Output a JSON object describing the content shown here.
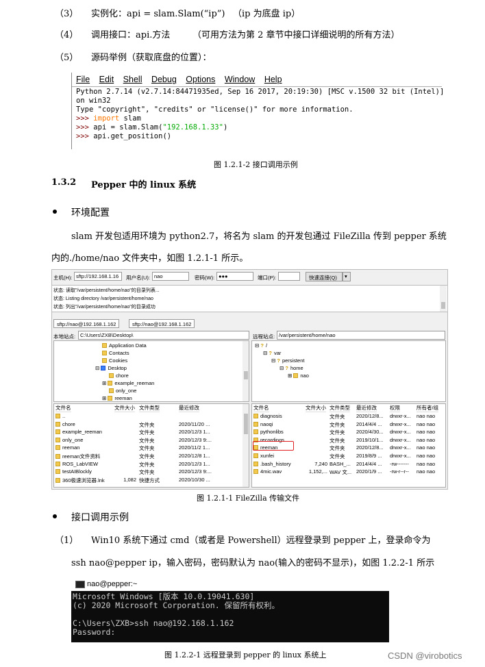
{
  "steps": {
    "s3_num": "（3）",
    "s3_text": "实例化：api = slam.Slam(“ip”)",
    "s3_note": "（ip 为底盘 ip）",
    "s4_num": "（4）",
    "s4_text": "调用接口：api.方法",
    "s4_note": "（可用方法为第 2 章节中接口详细说明的所有方法）",
    "s5_num": "（5）",
    "s5_text": "源码举例（获取底盘的位置）："
  },
  "idle": {
    "menu": [
      "File",
      "Edit",
      "Shell",
      "Debug",
      "Options",
      "Window",
      "Help"
    ],
    "line1": "Python 2.7.14 (v2.7.14:84471935ed, Sep 16 2017, 20:19:30) [MSC v.1500 32 bit (Intel)]",
    "line2": "on win32",
    "line3": "Type \"copyright\", \"credits\" or \"license()\" for more information.",
    "prompt": ">>> ",
    "cmd1_kw": "import",
    "cmd1_rest": " slam",
    "cmd2_pre": "api = slam.Slam(",
    "cmd2_str": "\"192.168.1.33\"",
    "cmd2_post": ")",
    "cmd3": "api.get_position()"
  },
  "fig1_caption": "图 1.2.1-2  接口调用示例",
  "section": {
    "number": "1.3.2",
    "title": "Pepper 中的 linux 系统"
  },
  "bullet1": "环境配置",
  "para1_line1": "slam 开发包适用环境为 python2.7，将名为 slam 的开发包通过 FileZilla 传到 pepper 系统",
  "para1_line2": "内的./home/nao 文件夹中，如图 1.2.1-1 所示。",
  "filezilla": {
    "host_label": "主机(H):",
    "host_value": "sftp://192.168.1.16",
    "user_label": "用户名(U):",
    "user_value": "nao",
    "pass_label": "密码(W):",
    "pass_value": "●●●",
    "port_label": "端口(P):",
    "port_value": "",
    "connect_button": "快速连接(Q)",
    "log": [
      "状态: 读取\"/var/persistent/home/nao\"的目录列表...",
      "状态: Listing directory /var/persistent/home/nao",
      "状态: 列出\"/var/persistent/home/nao\"的目录成功"
    ],
    "tabs": [
      "sftp://nao@192.168.1.162",
      "sftp://nao@192.168.1.162"
    ],
    "local_label": "本地站点:",
    "local_path": "C:\\Users\\ZXB\\Desktop\\",
    "remote_label": "远程站点:",
    "remote_path": "/var/persistent/home/nao",
    "local_tree": [
      "Application Data",
      "Contacts",
      "Cookies",
      "Desktop",
      "chore",
      "example_reeman",
      "only_one",
      "reeman"
    ],
    "remote_tree": [
      "/",
      "var",
      "persistent",
      "home",
      "nao"
    ],
    "local_headers": [
      "文件名",
      "文件大小",
      "文件类型",
      "最近修改"
    ],
    "local_files": [
      {
        "name": "..",
        "size": "",
        "type": "",
        "date": ""
      },
      {
        "name": "chore",
        "size": "",
        "type": "文件夹",
        "date": "2020/11/20 ..."
      },
      {
        "name": "example_reeman",
        "size": "",
        "type": "文件夹",
        "date": "2020/12/3 1..."
      },
      {
        "name": "only_one",
        "size": "",
        "type": "文件夹",
        "date": "2020/12/3 9:..."
      },
      {
        "name": "reeman",
        "size": "",
        "type": "文件夹",
        "date": "2020/11/2 1..."
      },
      {
        "name": "reeman文件资料",
        "size": "",
        "type": "文件夹",
        "date": "2020/12/8 1..."
      },
      {
        "name": "ROS_LabVIEW",
        "size": "",
        "type": "文件夹",
        "date": "2020/12/3 1..."
      },
      {
        "name": "testAIBlockly",
        "size": "",
        "type": "文件夹",
        "date": "2020/12/3 9:..."
      },
      {
        "name": "360极速浏览器.lnk",
        "size": "1,082",
        "type": "快捷方式",
        "date": "2020/10/30 ..."
      }
    ],
    "remote_headers": [
      "文件名",
      "文件大小",
      "文件类型",
      "最近修改",
      "权限",
      "所有者/组"
    ],
    "remote_files": [
      {
        "name": "diagnosis",
        "size": "",
        "type": "文件夹",
        "date": "2020/12/8...",
        "perm": "drwxr-x...",
        "owner": "nao nao"
      },
      {
        "name": "naoqi",
        "size": "",
        "type": "文件夹",
        "date": "2014/4/4 ...",
        "perm": "drwxr-x...",
        "owner": "nao nao"
      },
      {
        "name": "pythonlibs",
        "size": "",
        "type": "文件夹",
        "date": "2020/4/30...",
        "perm": "drwxr-x...",
        "owner": "nao nao"
      },
      {
        "name": "recordings",
        "size": "",
        "type": "文件夹",
        "date": "2019/10/1...",
        "perm": "drwxr-x...",
        "owner": "nao nao"
      },
      {
        "name": "reeman",
        "size": "",
        "type": "文件夹",
        "date": "2020/12/8...",
        "perm": "drwxr-x...",
        "owner": "nao nao"
      },
      {
        "name": "xunfei",
        "size": "",
        "type": "文件夹",
        "date": "2019/8/9 ...",
        "perm": "drwxr-x...",
        "owner": "nao nao"
      },
      {
        "name": ".bash_history",
        "size": "7,240",
        "type": "BASH_...",
        "date": "2014/4/4 ...",
        "perm": "-rw-------",
        "owner": "nao nao"
      },
      {
        "name": "4mic.wav",
        "size": "1,152,...",
        "type": "WAV 文...",
        "date": "2020/1/9 ...",
        "perm": "-rw-r--r--",
        "owner": "nao nao"
      }
    ]
  },
  "fig2_caption": "图 1.2.1-1    FileZilla 传输文件",
  "bullet2": "接口调用示例",
  "step1_num": "（1）",
  "step1_line1": "Win10 系统下通过 cmd（或者是 Powershell）远程登录到 pepper 上，登录命令为",
  "step1_line2": "ssh nao@pepper ip，输入密码，密码默认为 nao(输入的密码不显示)，如图 1.2.2-1 所示",
  "terminal": {
    "title": "nao@pepper:~",
    "line1": "Microsoft Windows [版本 10.0.19041.630]",
    "line2": "(c) 2020 Microsoft Corporation. 保留所有权利。",
    "line3": "",
    "line4": "C:\\Users\\ZXB>ssh nao@192.168.1.162",
    "line5": "Password:"
  },
  "fig3_caption": "图 1.2.2-1    远程登录到 pepper 的 linux 系统上",
  "watermark": "CSDN @virobotics"
}
